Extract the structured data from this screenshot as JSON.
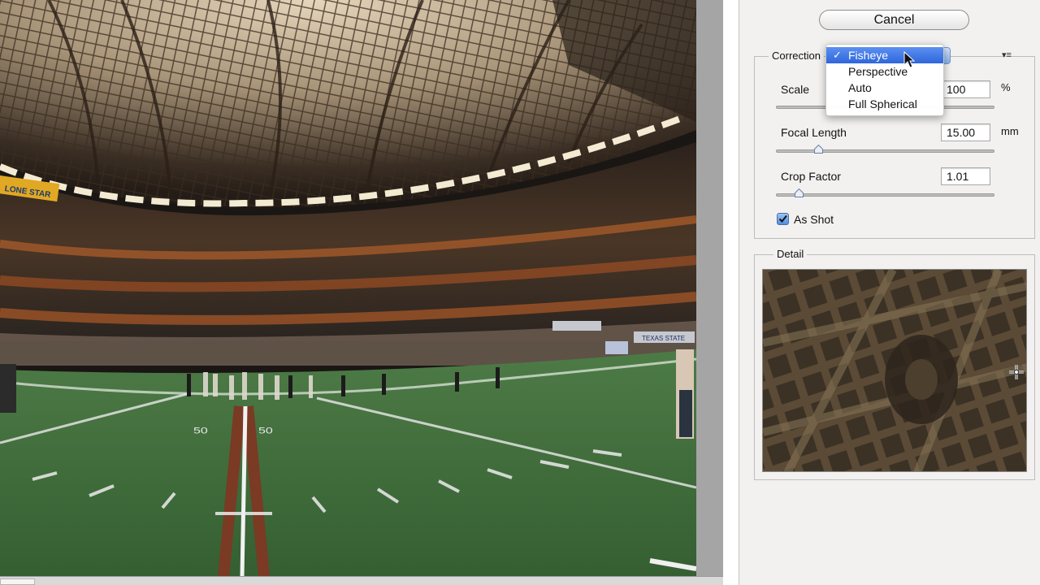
{
  "buttons": {
    "cancel": "Cancel"
  },
  "correction": {
    "legend": "Correction",
    "flyout_icon": "▾≡",
    "dropdown": {
      "selected": "Fisheye",
      "checkmark": "✓",
      "options": [
        "Fisheye",
        "Perspective",
        "Auto",
        "Full Spherical"
      ]
    },
    "scale": {
      "label": "Scale",
      "value": "100",
      "unit": "%"
    },
    "focal_length": {
      "label": "Focal Length",
      "value": "15.00",
      "unit": "mm"
    },
    "crop_factor": {
      "label": "Crop Factor",
      "value": "1.01"
    },
    "as_shot": {
      "label": "As Shot",
      "checked": true
    }
  },
  "detail": {
    "legend": "Detail"
  },
  "photo": {
    "banner": "LONE STAR",
    "yard_numbers": [
      "50",
      "50"
    ],
    "sign_right": "TEXAS STATE"
  },
  "colors": {
    "accent": "#3b72e0",
    "field": "#3f6e3a",
    "panel": "#f3f1f0"
  }
}
